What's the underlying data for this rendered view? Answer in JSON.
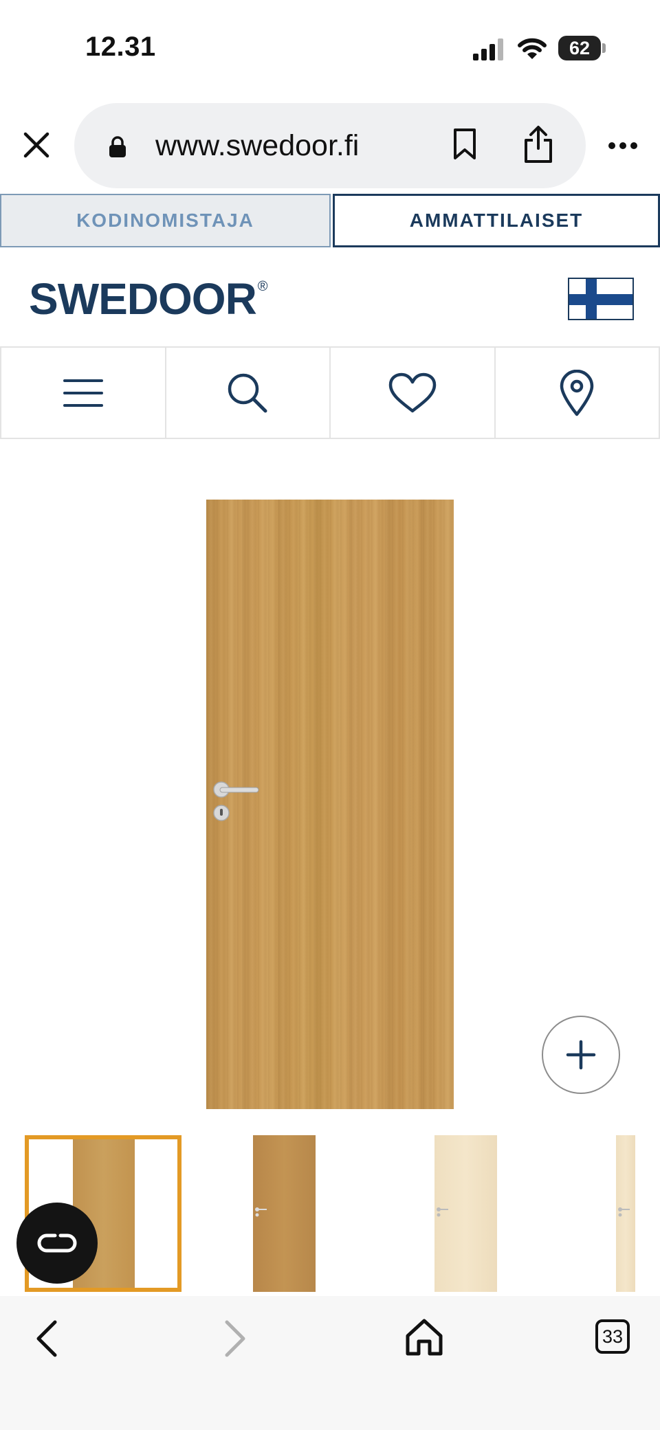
{
  "status_bar": {
    "time": "12.31",
    "battery": "62"
  },
  "browser": {
    "url": "www.swedoor.fi",
    "tabs_count": "33"
  },
  "site_tabs": {
    "homeowner": "KODINOMISTAJA",
    "professionals": "AMMATTILAISET"
  },
  "header": {
    "logo": "SWEDOOR",
    "registered": "®"
  },
  "nav_icons": [
    "menu-icon",
    "search-icon",
    "heart-icon",
    "location-pin-icon"
  ],
  "product_images": [
    {
      "name": "oak-door-selected",
      "selected": true
    },
    {
      "name": "oak-door"
    },
    {
      "name": "birch-door"
    },
    {
      "name": "birch-door"
    }
  ],
  "colors": {
    "brand": "#1b3a5c",
    "selected_thumb_border": "#e39a25",
    "tab_inactive_text": "#6f93b8"
  }
}
